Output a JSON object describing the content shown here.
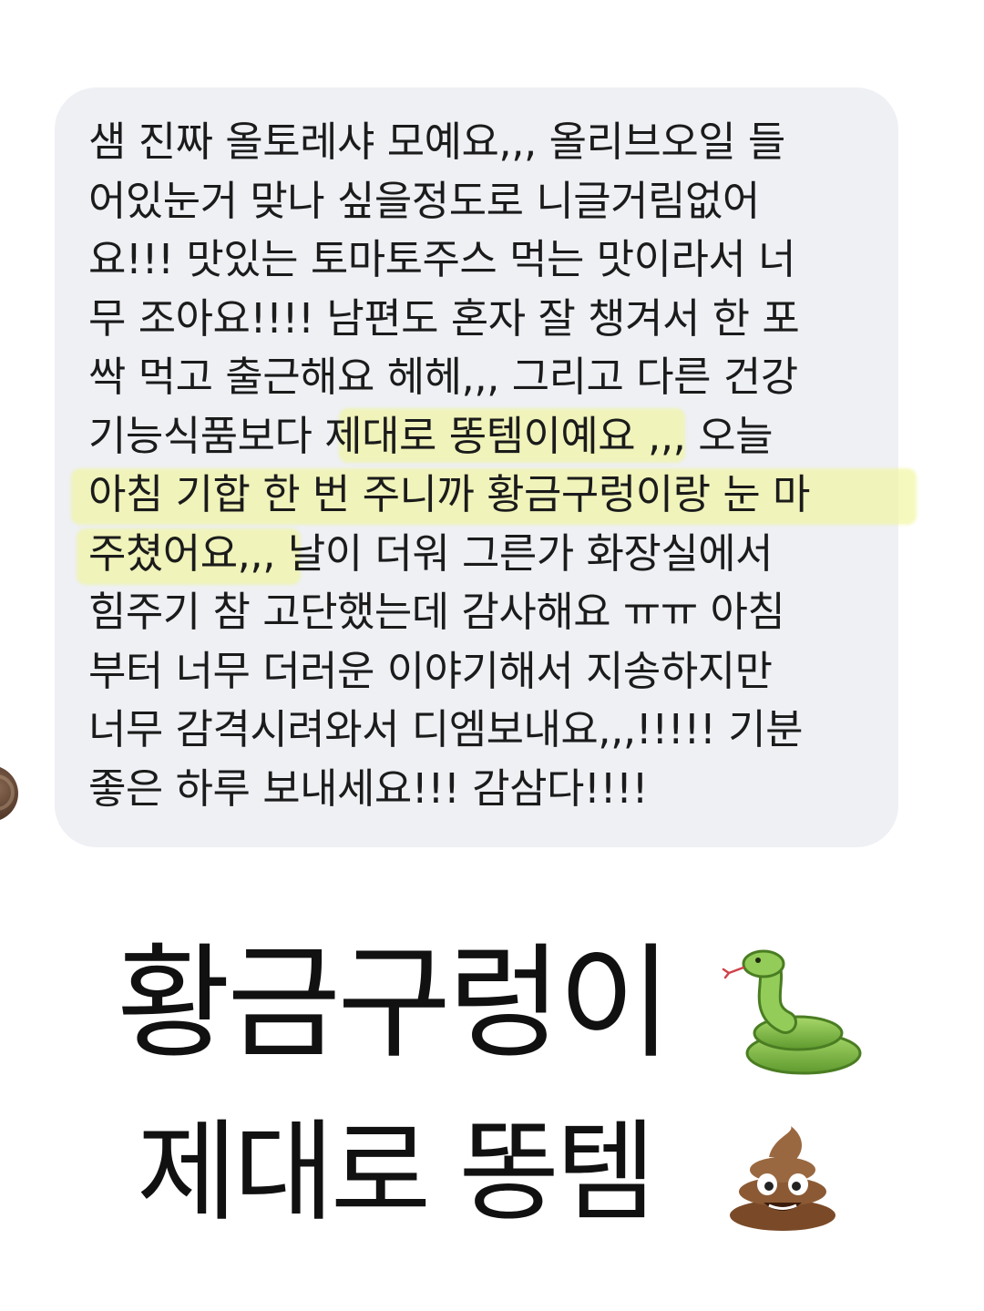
{
  "message": {
    "lines": [
      "샘 진짜 올토레샤 모예요,,, 올리브오일 들",
      "어있눈거 맞나 싶을정도로 니글거림없어",
      "요!!! 맛있는 토마토주스 먹는 맛이라서 너",
      "무 조아요!!!! 남편도 혼자 잘 챙겨서 한 포",
      "싹 먹고 출근해요 헤헤,,, 그리고 다른 건강",
      "기능식품보다 제대로 똥템이예요 ,,, 오늘",
      "아침 기합 한 번 주니까 황금구렁이랑 눈 마",
      "주쳤어요,,, 날이 더워 그른가 화장실에서",
      "힘주기 참 고단했는데 감사해요 ㅠㅠ 아침",
      "부터 너무 더러운 이야기해서 지송하지만",
      "너무 감격시려와서 디엠보내요,,,!!!!! 기분",
      "좋은 하루 보내세요!!! 감삼다!!!!"
    ],
    "highlight_color": "#f0f596"
  },
  "caption": {
    "line1": "황금구렁이",
    "line2": "제대로 똥템"
  },
  "icons": {
    "snake": "snake-emoji",
    "poop": "pile-of-poo-emoji",
    "avatar": "sender-avatar"
  }
}
